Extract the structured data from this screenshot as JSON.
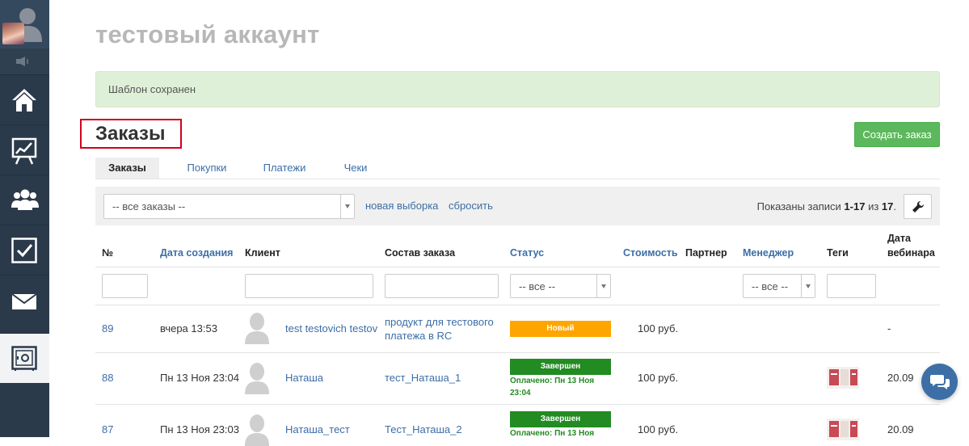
{
  "account": {
    "title": "тестовый аккаунт"
  },
  "alert": {
    "text": "Шаблон сохранен"
  },
  "page": {
    "title": "Заказы",
    "create_button": "Создать заказ"
  },
  "tabs": [
    {
      "label": "Заказы",
      "active": true
    },
    {
      "label": "Покупки",
      "active": false
    },
    {
      "label": "Платежи",
      "active": false
    },
    {
      "label": "Чеки",
      "active": false
    }
  ],
  "filter": {
    "selection_value": "-- все заказы --",
    "new_selection": "новая выборка",
    "reset": "сбросить",
    "shown_prefix": "Показаны записи ",
    "shown_range": "1-17",
    "shown_of": " из ",
    "shown_total": "17",
    "shown_suffix": "."
  },
  "table": {
    "headers": {
      "num": "№",
      "created": "Дата создания",
      "client": "Клиент",
      "composition": "Состав заказа",
      "status": "Статус",
      "cost": "Стоимость",
      "partner": "Партнер",
      "manager": "Менеджер",
      "tags": "Теги",
      "webinar_line1": "Дата",
      "webinar_line2": "вебинара"
    },
    "status_filter": "-- все --",
    "manager_filter": "-- все --",
    "rows": [
      {
        "num": "89",
        "created": "вчера 13:53",
        "client": "test testovich testov",
        "composition_line1": "продукт для тестового",
        "composition_line2": "платежа в RC",
        "status": "Новый",
        "paid": "",
        "cost": "100 руб.",
        "webinar": "-"
      },
      {
        "num": "88",
        "created": "Пн 13 Ноя 23:04",
        "client": "Наташа",
        "composition_line1": "тест_Наташа_1",
        "composition_line2": "",
        "status": "Завершен",
        "paid_line1": "Оплачено: Пн 13 Ноя",
        "paid_line2": "23:04",
        "cost": "100 руб.",
        "webinar": "20.09"
      },
      {
        "num": "87",
        "created": "Пн 13 Ноя 23:03",
        "client": "Наташа_тест",
        "composition_line1": "Тест_Наташа_2",
        "composition_line2": "",
        "status": "Завершен",
        "paid_line1": "Оплачено: Пн 13 Ноя",
        "paid_line2": "",
        "cost": "100 руб.",
        "webinar": "20.09"
      }
    ]
  },
  "colors": {
    "sidebar": "#2b3a4a",
    "accent_link": "#3d6ea6",
    "create_button": "#5cb85c",
    "status_new": "#ffa500",
    "status_done": "#228b22",
    "highlight_box": "#d0021b"
  }
}
